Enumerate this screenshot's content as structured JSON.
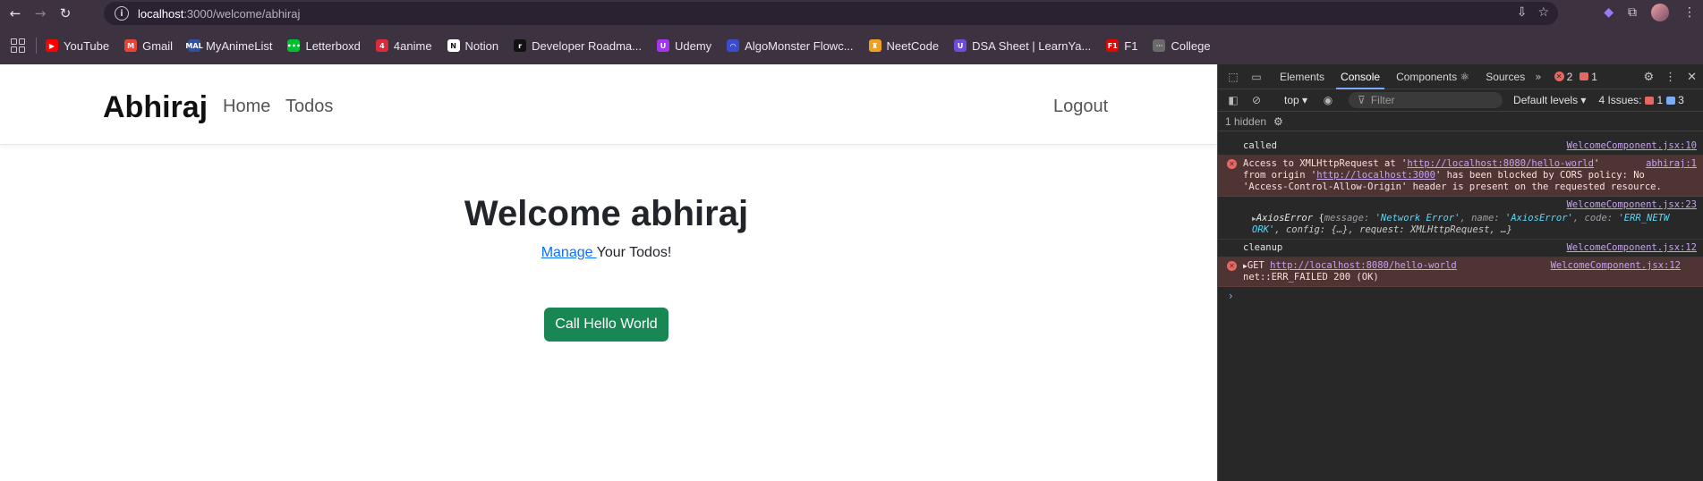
{
  "browser": {
    "url_host": "localhost",
    "url_path": ":3000/welcome/abhiraj",
    "bookmarks": [
      {
        "label": "YouTube",
        "color": "#ff0000",
        "glyph": "▶"
      },
      {
        "label": "Gmail",
        "color": "#ea4335",
        "glyph": "M"
      },
      {
        "label": "MyAnimeList",
        "color": "#2e51a2",
        "glyph": "MAL"
      },
      {
        "label": "Letterboxd",
        "color": "#00c030",
        "glyph": "•••"
      },
      {
        "label": "4anime",
        "color": "#d92b3a",
        "glyph": "4"
      },
      {
        "label": "Notion",
        "color": "#ffffff",
        "glyph": "N"
      },
      {
        "label": "Developer Roadma...",
        "color": "#111111",
        "glyph": "r"
      },
      {
        "label": "Udemy",
        "color": "#a435f0",
        "glyph": "U"
      },
      {
        "label": "AlgoMonster Flowc...",
        "color": "#3b4cca",
        "glyph": "◠"
      },
      {
        "label": "NeetCode",
        "color": "#f0a020",
        "glyph": "♜"
      },
      {
        "label": "DSA Sheet | LearnYa...",
        "color": "#6e4bd8",
        "glyph": "U"
      },
      {
        "label": "F1",
        "color": "#e10600",
        "glyph": "F1"
      },
      {
        "label": "College",
        "color": "#6a6a6a",
        "glyph": "ᐧᐧᐧ"
      }
    ]
  },
  "app": {
    "brand": "Abhiraj",
    "nav_home": "Home",
    "nav_todos": "Todos",
    "nav_logout": "Logout",
    "welcome_title": "Welcome abhiraj",
    "manage_link": "Manage ",
    "manage_rest": "Your Todos!",
    "hello_button": "Call Hello World"
  },
  "devtools": {
    "tabs": [
      "Elements",
      "Console",
      "Components ⚛",
      "Sources"
    ],
    "active_tab": "Console",
    "error_count": "2",
    "warn_count": "1",
    "context": "top ▾",
    "filter_placeholder": "Filter",
    "levels": "Default levels ▾",
    "issues_label": "4 Issues:",
    "issues_errors": "1",
    "issues_info": "3",
    "hidden": "1 hidden",
    "messages": {
      "m1_text": "called",
      "m1_src": "WelcomeComponent.jsx:10",
      "m2_a": "Access to XMLHttpRequest at '",
      "m2_url1": "http://localhost:8080/hello-world",
      "m2_b": "'",
      "m2_src": "abhiraj:1",
      "m2_c": "from origin '",
      "m2_url2": "http://localhost:3000",
      "m2_d": "' has been blocked by CORS policy: No",
      "m2_e": "'Access-Control-Allow-Origin' header is present on the requested resource.",
      "m3_src": "WelcomeComponent.jsx:23",
      "m3_name": "AxiosError",
      "m3_k1": "message: ",
      "m3_v1": "'Network Error'",
      "m3_k2": ", name: ",
      "m3_v2": "'AxiosError'",
      "m3_k3": ", code: ",
      "m3_v3": "'ERR_NETW",
      "m3_v3b": "ORK'",
      "m3_rest": ", config: {…}, request: XMLHttpRequest, …}",
      "m4_text": "cleanup",
      "m4_src": "WelcomeComponent.jsx:12",
      "m5_get": "GET ",
      "m5_url": "http://localhost:8080/hello-world",
      "m5_src": "WelcomeComponent.jsx:12",
      "m5_status": "net::ERR_FAILED 200 (OK)"
    }
  }
}
